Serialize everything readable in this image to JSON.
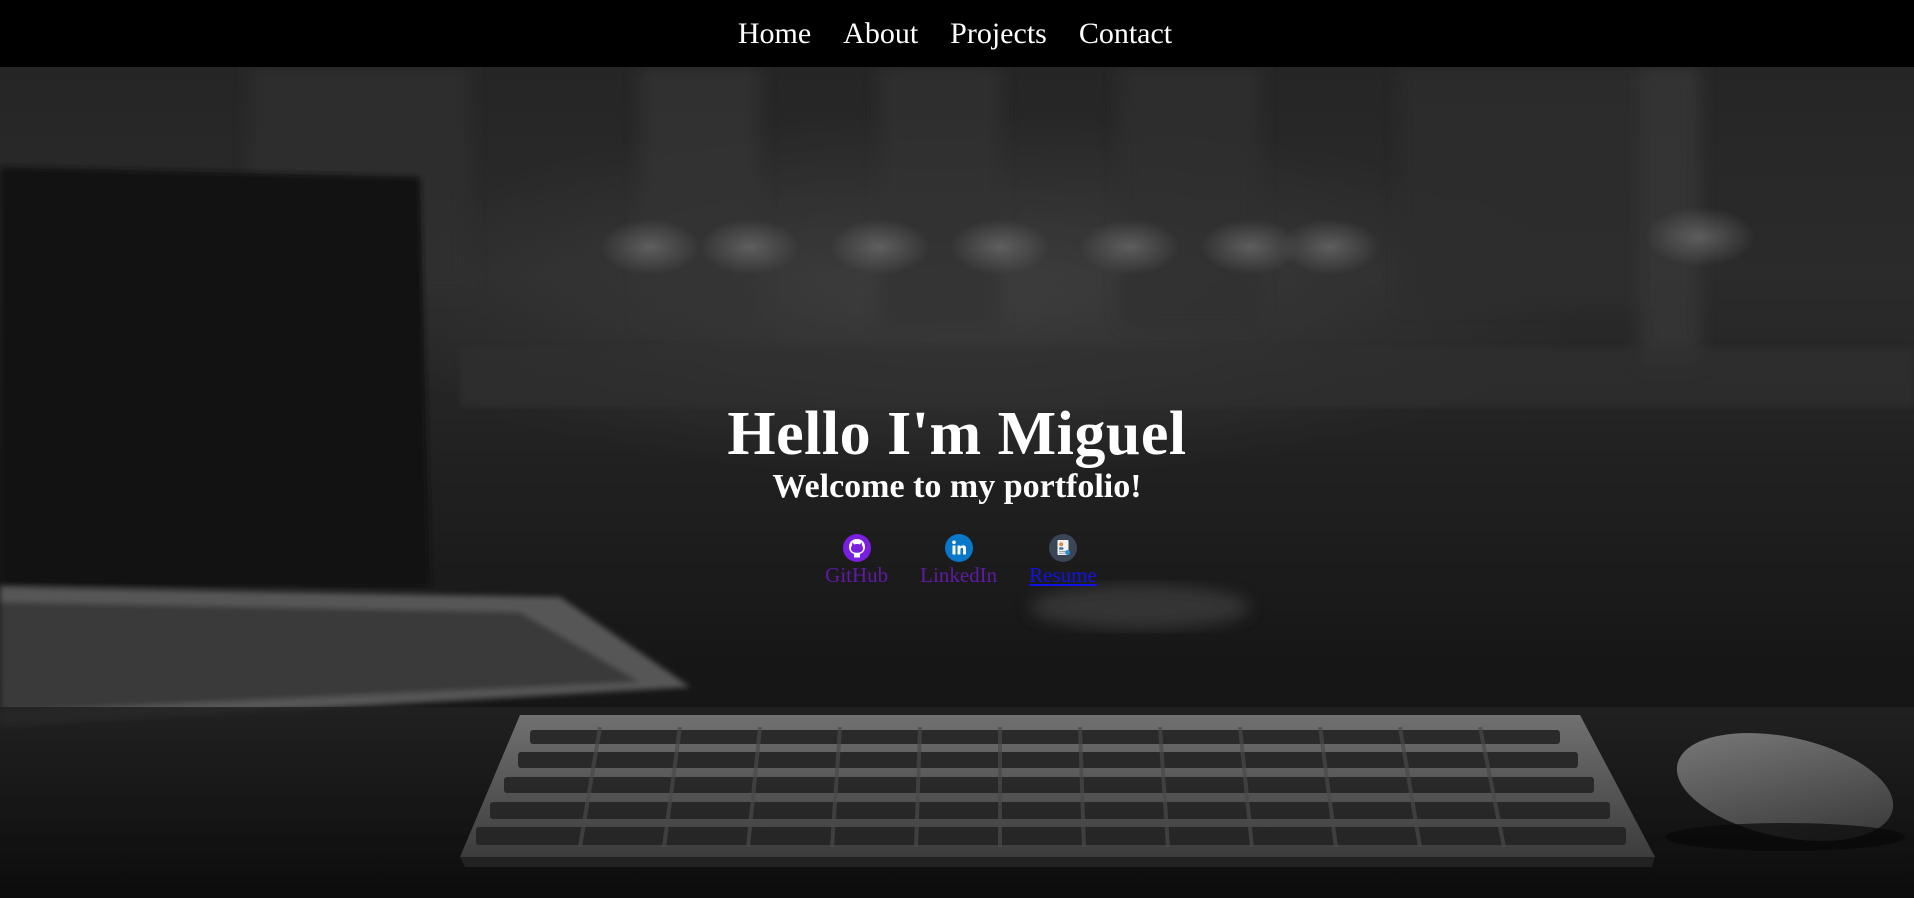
{
  "nav": {
    "items": [
      {
        "label": "Home"
      },
      {
        "label": "About"
      },
      {
        "label": "Projects"
      },
      {
        "label": "Contact"
      }
    ]
  },
  "hero": {
    "title": "Hello I'm Miguel",
    "subtitle": "Welcome to my portfolio!",
    "links": [
      {
        "label": "GitHub",
        "icon": "github-icon"
      },
      {
        "label": "LinkedIn",
        "icon": "linkedin-icon"
      },
      {
        "label": "Resume",
        "icon": "resume-icon"
      }
    ]
  },
  "colors": {
    "nav_background": "#000000",
    "text": "#ffffff",
    "visited_link": "#5f1aa6",
    "unvisited_link": "#1212e6",
    "github_icon": "#7a1fe0",
    "linkedin_icon": "#0a78c8",
    "resume_icon": "#3a4656"
  }
}
